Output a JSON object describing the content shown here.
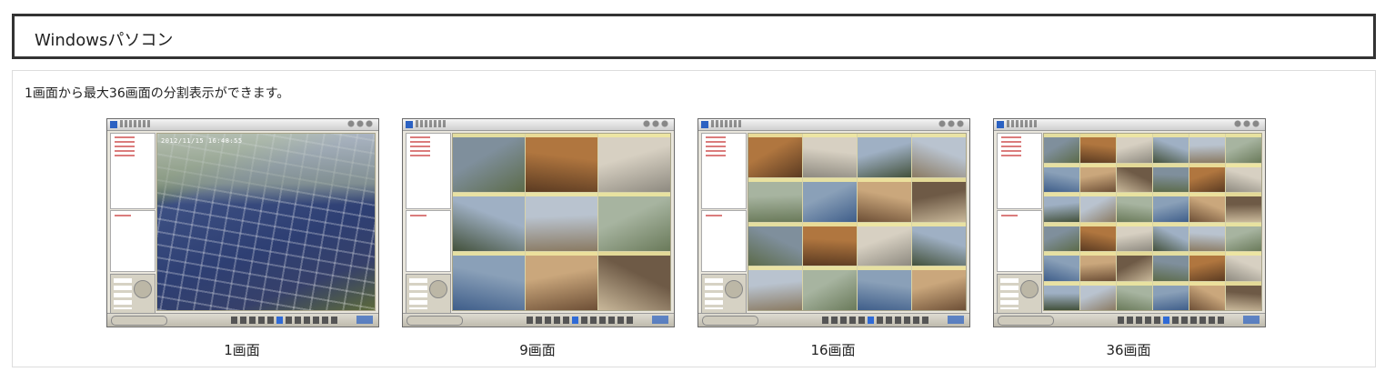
{
  "section_title": "Windowsパソコン",
  "description": "1画面から最大36画面の分割表示ができます。",
  "screenshots": [
    {
      "caption": "1画面",
      "split": 1,
      "timestamp": "2012/11/15 16:48:55"
    },
    {
      "caption": "9画面",
      "split": 9
    },
    {
      "caption": "16画面",
      "split": 16
    },
    {
      "caption": "36画面",
      "split": 36
    }
  ],
  "colors": {
    "title_border": "#333333",
    "content_border": "#dddddd",
    "camview_blue": "#2b61c2",
    "cell_header": "#efe7a0"
  },
  "icons": [
    "camview-logo-icon",
    "window-buttons-icon",
    "ptz-pad-icon",
    "layout-buttons-icon"
  ]
}
